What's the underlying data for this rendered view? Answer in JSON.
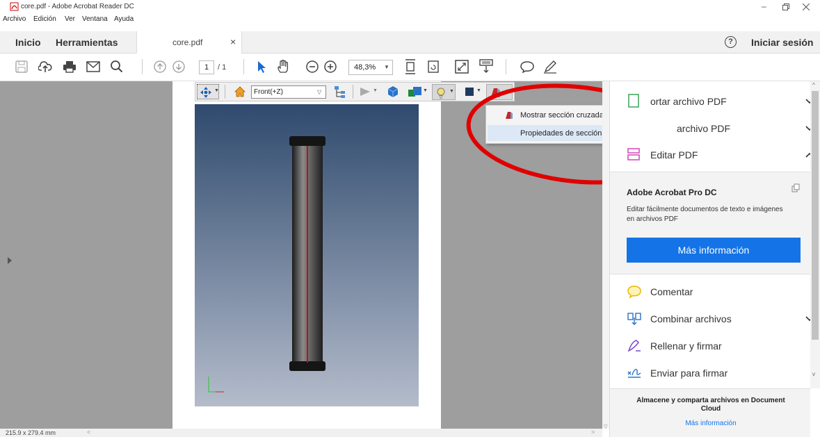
{
  "window": {
    "title": "core.pdf - Adobe Acrobat Reader DC"
  },
  "menu": [
    "Archivo",
    "Edición",
    "Ver",
    "Ventana",
    "Ayuda"
  ],
  "tabs": {
    "home": "Inicio",
    "tools": "Herramientas",
    "doc": "core.pdf",
    "close": "×"
  },
  "account": {
    "signin": "Iniciar sesión",
    "help": "?"
  },
  "toolbar": {
    "page_current": "1",
    "page_total": "/ 1",
    "zoom": "48,3%"
  },
  "toolbar3d": {
    "view": "Front(+Z)"
  },
  "context_menu": {
    "items": [
      "Mostrar sección cruzada",
      "Propiedades de sección cruzada..."
    ]
  },
  "right_panel": {
    "items": [
      {
        "label": "Exportar archivo PDF",
        "visible_label": "ortar archivo PDF",
        "state": "collapsed"
      },
      {
        "label": "Crear archivo PDF",
        "visible_label": "archivo PDF",
        "state": "collapsed"
      },
      {
        "label": "Editar PDF",
        "visible_label": "Editar PDF",
        "state": "expanded"
      }
    ],
    "promo_title": "Adobe Acrobat Pro DC",
    "promo_text": "Editar fácilmente documentos de texto e imágenes en archivos PDF",
    "promo_button": "Más información",
    "tools": [
      {
        "label": "Comentar",
        "icon": "comment-icon"
      },
      {
        "label": "Combinar archivos",
        "icon": "combine-icon"
      },
      {
        "label": "Rellenar y firmar",
        "icon": "fill-sign-icon"
      },
      {
        "label": "Enviar para firmar",
        "icon": "send-sign-icon"
      }
    ],
    "cloud_title": "Almacene y comparta archivos en Document Cloud",
    "cloud_link": "Más información"
  },
  "status": {
    "page_size": "215.9 x 279.4 mm"
  },
  "colors": {
    "accent": "#1473e6",
    "annotation": "#e00000"
  }
}
